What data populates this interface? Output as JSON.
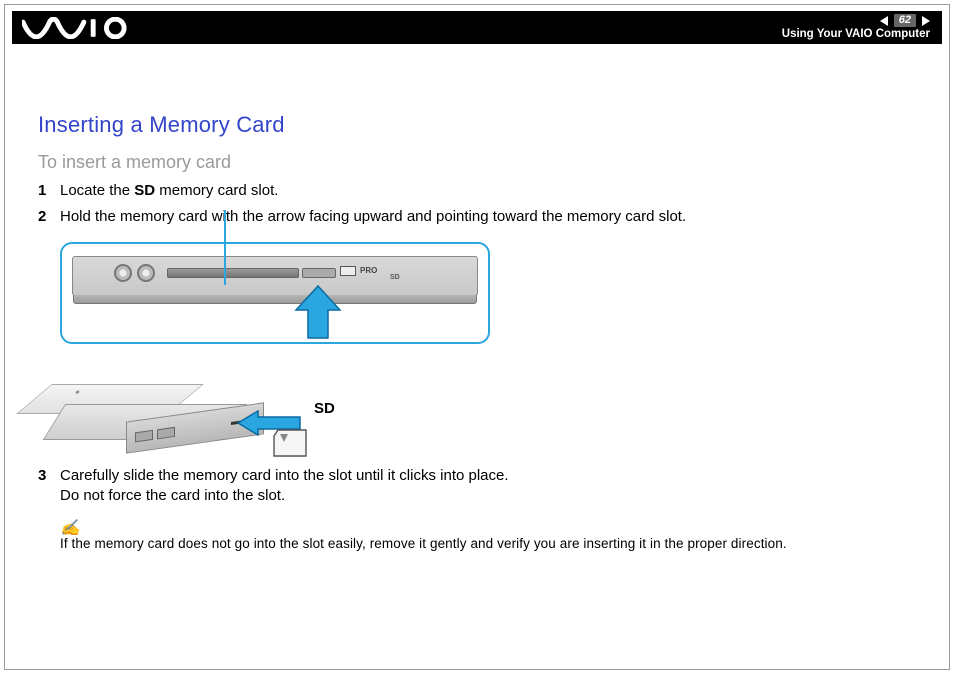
{
  "header": {
    "brand": "VAIO",
    "page_number": "62",
    "doc_title": "Using Your VAIO Computer"
  },
  "page": {
    "heading": "Inserting a Memory Card",
    "subheading": "To insert a memory card"
  },
  "steps": [
    {
      "num": "1",
      "pre": "Locate the ",
      "bold": "SD",
      "post": " memory card slot."
    },
    {
      "num": "2",
      "pre": "Hold the memory card with the arrow facing upward and pointing toward the memory card slot.",
      "bold": "",
      "post": ""
    },
    {
      "num": "3",
      "pre": "Carefully slide the memory card into the slot until it clicks into place.",
      "bold": "",
      "post": "",
      "line2": "Do not force the card into the slot."
    }
  ],
  "illustration": {
    "pro_label": "PRO",
    "sd_mark": "SD",
    "sd_callout": "SD"
  },
  "note": {
    "icon": "✍",
    "text": "If the memory card does not go into the slot easily, remove it gently and verify you are inserting it in the proper direction."
  }
}
